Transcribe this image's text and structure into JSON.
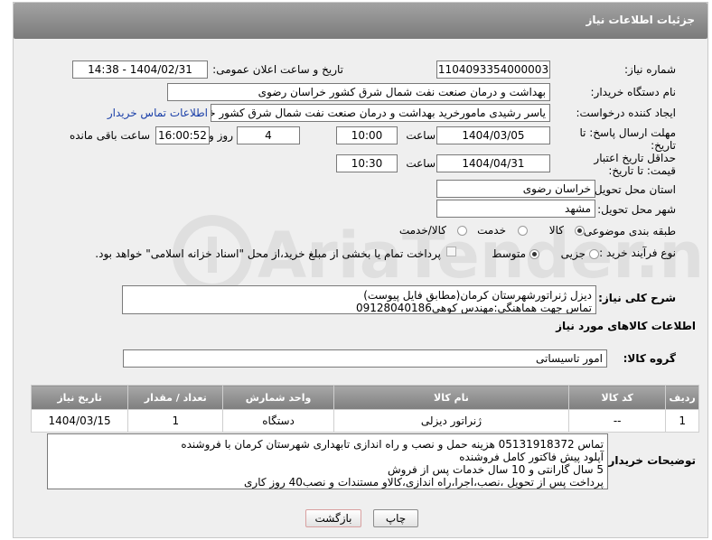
{
  "header": {
    "title": "جزئیات اطلاعات نیاز"
  },
  "form": {
    "need_number_label": "شماره نیاز:",
    "need_number": "1104093354000003",
    "announce_label": "تاریخ و ساعت اعلان عمومی:",
    "announce_value": "1404/02/31 - 14:38",
    "buyer_org_label": "نام دستگاه خریدار:",
    "buyer_org": "بهداشت و درمان صنعت نفت شمال شرق کشور   خراسان رضوی",
    "creator_label": "ایجاد کننده درخواست:",
    "creator": "یاسر رشیدی مامورخرید بهداشت و درمان صنعت نفت شمال شرق کشور   خراسان رضوی",
    "contact_link": "اطلاعات تماس خریدار",
    "deadline_label": "مهلت ارسال پاسخ: تا تاریخ:",
    "deadline_date": "1404/03/05",
    "time_label": "ساعت",
    "deadline_time": "10:00",
    "days_value": "4",
    "days_label": "روز و",
    "remaining_time": "16:00:52",
    "remaining_label": "ساعت باقی مانده",
    "validity_label": "حداقل تاریخ اعتبار قیمت: تا تاریخ:",
    "validity_date": "1404/04/31",
    "validity_time": "10:30",
    "province_label": "استان محل تحویل:",
    "province": "خراسان رضوی",
    "city_label": "شهر محل تحویل:",
    "city": "مشهد",
    "category_label": "طبقه بندی موضوعی:",
    "category_options": [
      "کالا",
      "خدمت",
      "کالا/خدمت"
    ],
    "category_selected": "کالا",
    "process_label": "نوع فرآیند خرید :",
    "process_options": [
      "جزیی",
      "متوسط"
    ],
    "process_selected": "متوسط",
    "payment_note": "پرداخت تمام یا بخشی از مبلغ خرید،از محل \"اسناد خزانه اسلامی\" خواهد بود."
  },
  "description": {
    "label": "شرح کلی نیاز:",
    "lines": [
      "دیزل ژنراتورشهرستان کرمان(مطابق فایل پیوست)",
      "تماس جهت هماهنگی:مهندس کوهی09128040186"
    ]
  },
  "goods_info": {
    "title": "اطلاعات کالاهای مورد نیاز",
    "group_label": "گروه کالا:",
    "group_value": "امور تاسیساتی"
  },
  "table": {
    "headers": [
      "ردیف",
      "کد کالا",
      "نام کالا",
      "واحد شمارش",
      "تعداد / مقدار",
      "تاریخ نیاز"
    ],
    "rows": [
      [
        "1",
        "--",
        "ژنراتور دیزلی",
        "دستگاه",
        "1",
        "1404/03/15"
      ]
    ]
  },
  "buyer_notes": {
    "label": "توضیحات خریدار:",
    "lines": [
      "تماس 05131918372 هزینه حمل و نصب و راه اندازی تابهداری شهرستان کرمان با فروشنده",
      "آپلود پیش فاکتور کامل فروشنده",
      "5 سال گارانتی و 10 سال خدمات پس از فروش",
      "پرداخت پس از تحویل ،نصب،اجرا،راه اندازی،کالاو مستندات و نصب40 روز کاری"
    ]
  },
  "buttons": {
    "print": "چاپ",
    "back": "بازگشت"
  },
  "watermark": {
    "text": "AriaTender.neT"
  },
  "colors": {
    "header": "#8a8a8a",
    "link": "#1a3fa8",
    "back_button_border": "#d9a0a0"
  }
}
